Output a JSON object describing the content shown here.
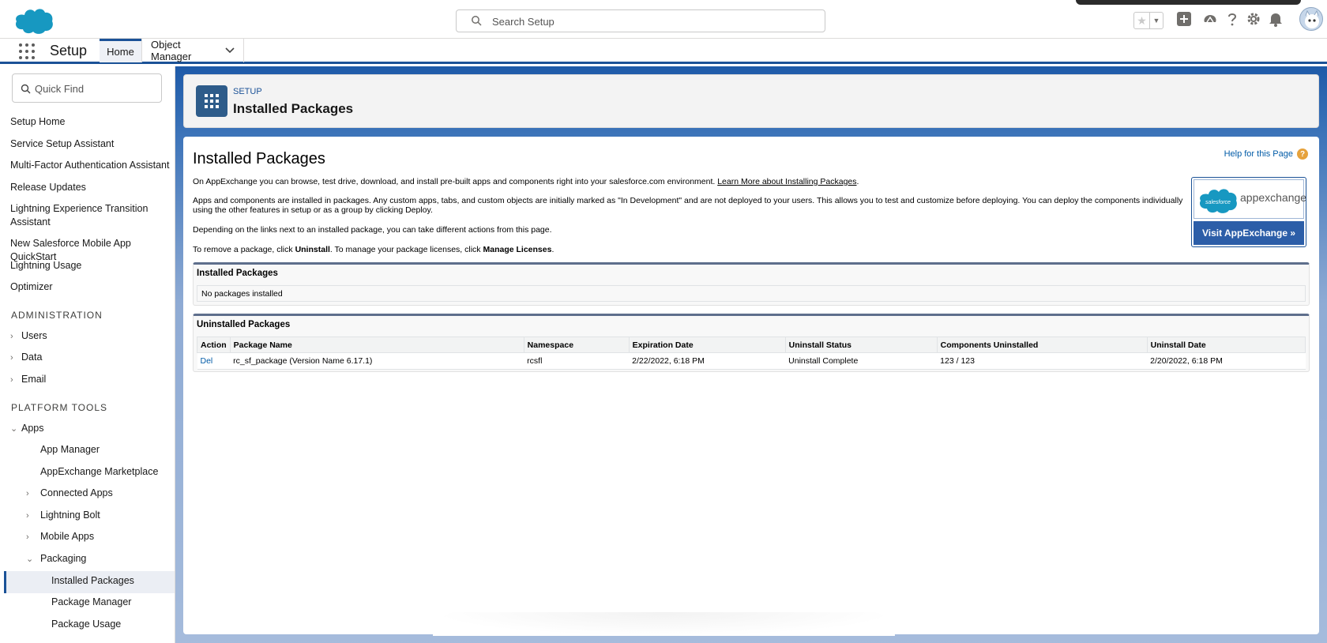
{
  "header": {
    "search_placeholder": "Search Setup",
    "icons": [
      "favorites-star-icon",
      "add-icon",
      "trailhead-icon",
      "help-icon",
      "settings-gear-icon",
      "notifications-bell-icon",
      "avatar"
    ]
  },
  "nav": {
    "app_name": "Setup",
    "tabs": [
      {
        "label": "Home"
      },
      {
        "label": "Object Manager"
      }
    ]
  },
  "sidebar": {
    "quickfind_placeholder": "Quick Find",
    "items": [
      {
        "label": "Setup Home"
      },
      {
        "label": "Service Setup Assistant"
      },
      {
        "label": "Multi-Factor Authentication Assistant"
      },
      {
        "label": "Release Updates"
      },
      {
        "label": "Lightning Experience Transition Assistant"
      },
      {
        "label": "New Salesforce Mobile App QuickStart"
      },
      {
        "label": "Lightning Usage"
      },
      {
        "label": "Optimizer"
      }
    ],
    "admin_heading": "ADMINISTRATION",
    "admin_items": [
      {
        "label": "Users"
      },
      {
        "label": "Data"
      },
      {
        "label": "Email"
      }
    ],
    "platform_heading": "PLATFORM TOOLS",
    "apps_label": "Apps",
    "apps_children": [
      {
        "label": "App Manager"
      },
      {
        "label": "AppExchange Marketplace"
      },
      {
        "label": "Connected Apps"
      },
      {
        "label": "Lightning Bolt"
      },
      {
        "label": "Mobile Apps"
      },
      {
        "label": "Packaging"
      }
    ],
    "packaging_children": [
      {
        "label": "Installed Packages"
      },
      {
        "label": "Package Manager"
      },
      {
        "label": "Package Usage"
      }
    ]
  },
  "page_header": {
    "eyebrow": "SETUP",
    "title": "Installed Packages"
  },
  "content": {
    "title": "Installed Packages",
    "help_link": "Help for this Page",
    "para1_text": "On AppExchange you can browse, test drive, download, and install pre-built apps and components right into your salesforce.com environment. ",
    "para1_link": "Learn More about Installing Packages",
    "para2": "Apps and components are installed in packages. Any custom apps, tabs, and custom objects are initially marked as \"In Development\" and are not deployed to your users. This allows you to test and customize before deploying. You can deploy the components individually using the other features in setup or as a group by clicking Deploy.",
    "para3": "Depending on the links next to an installed package, you can take different actions from this page.",
    "para4_a": "To remove a package, click ",
    "para4_b": "Uninstall",
    "para4_c": ". To manage your package licenses, click ",
    "para4_d": "Manage Licenses",
    "para4_e": ".",
    "appexchange_brand": "salesforce",
    "appexchange_word": "appexchange",
    "appexchange_button": "Visit AppExchange »",
    "installed_block_title": "Installed Packages",
    "installed_empty": "No packages installed",
    "uninstalled_block_title": "Uninstalled Packages",
    "table": {
      "headers": [
        "Action",
        "Package Name",
        "Namespace",
        "Expiration Date",
        "Uninstall Status",
        "Components Uninstalled",
        "Uninstall Date"
      ],
      "rows": [
        [
          "Del",
          "rc_sf_package (Version Name 6.17.1)",
          "rcsfl",
          "2/22/2022, 6:18 PM",
          "Uninstall Complete",
          "123 / 123",
          "2/20/2022, 6:18 PM"
        ]
      ]
    }
  },
  "colors": {
    "brand_blue": "#1b5297",
    "salesforce_cloud": "#1798c1",
    "link": "#015ba7"
  }
}
